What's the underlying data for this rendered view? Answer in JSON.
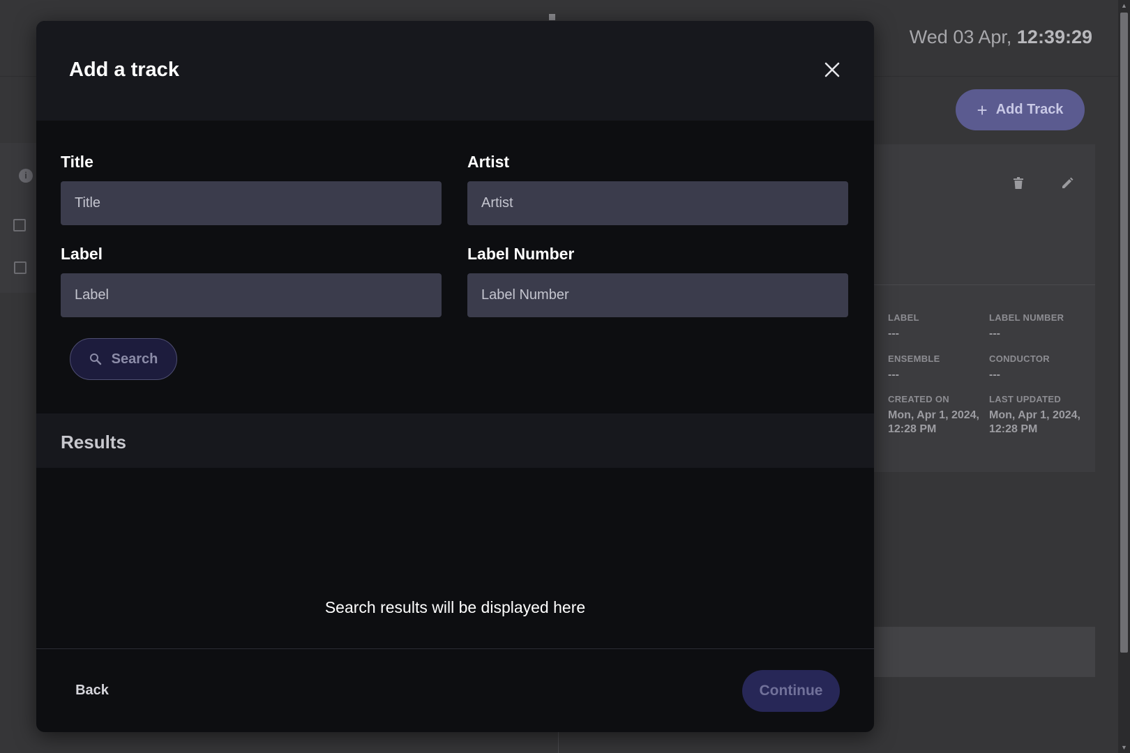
{
  "background": {
    "datetime": {
      "date": "Wed 03 Apr, ",
      "time": "12:39:29"
    },
    "add_track_button": {
      "icon": "plus-icon",
      "label": "Add Track"
    },
    "card": {
      "actions": [
        {
          "icon": "trash-icon"
        },
        {
          "icon": "pencil-icon"
        }
      ],
      "meta": [
        {
          "key": "LABEL",
          "value": "---"
        },
        {
          "key": "LABEL NUMBER",
          "value": "---"
        },
        {
          "key": "ENSEMBLE",
          "value": "---"
        },
        {
          "key": "CONDUCTOR",
          "value": "---"
        },
        {
          "key": "CREATED ON",
          "value": "Mon, Apr 1, 2024, 12:28 PM"
        },
        {
          "key": "LAST UPDATED",
          "value": "Mon, Apr 1, 2024, 12:28 PM"
        }
      ]
    },
    "left_panel": {
      "info_icon": "info-icon",
      "info_glyph": "i"
    }
  },
  "modal": {
    "title": "Add a track",
    "close_icon": "close-icon",
    "fields": {
      "title": {
        "label": "Title",
        "placeholder": "Title",
        "value": ""
      },
      "artist": {
        "label": "Artist",
        "placeholder": "Artist",
        "value": ""
      },
      "label": {
        "label": "Label",
        "placeholder": "Label",
        "value": ""
      },
      "label_number": {
        "label": "Label Number",
        "placeholder": "Label Number",
        "value": ""
      }
    },
    "search_button": {
      "icon": "search-icon",
      "label": "Search"
    },
    "results": {
      "heading": "Results",
      "empty_message": "Search results will be displayed here"
    },
    "footer": {
      "back_label": "Back",
      "continue_label": "Continue",
      "continue_disabled": true
    }
  },
  "colors": {
    "modal_bg": "#0d0e11",
    "header_bg": "#17181d",
    "input_bg": "#3b3c4c",
    "accent_disabled": "#272757",
    "bg_accent": "#5b5b90"
  }
}
